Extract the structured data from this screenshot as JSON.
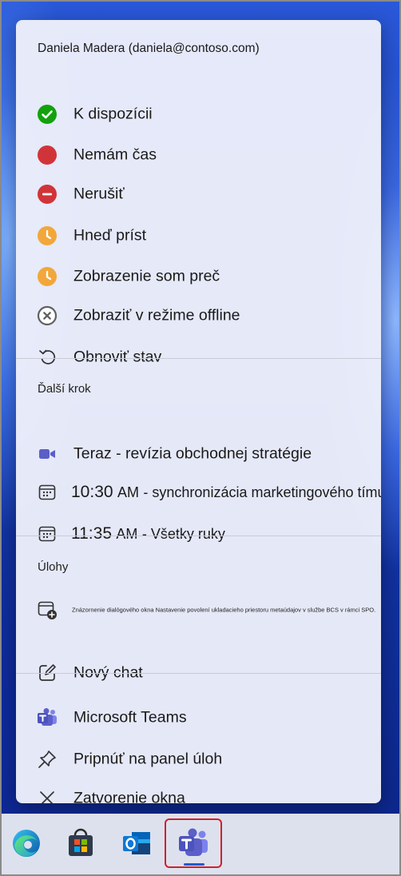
{
  "account": "Daniela Madera (daniela@contoso.com)",
  "status_items": [
    {
      "label": "K dispozícii",
      "icon": "available-icon",
      "color": "#13a10e"
    },
    {
      "label": "Nemám čas",
      "icon": "busy-icon",
      "color": "#d13438"
    },
    {
      "label": "Nerušiť",
      "icon": "do-not-disturb-icon",
      "color": "#d13438"
    },
    {
      "label": "Hneď príst",
      "icon": "be-right-back-icon",
      "color": "#f2a73b"
    },
    {
      "label": "Zobrazenie som preč",
      "icon": "away-icon",
      "color": "#f2a73b"
    },
    {
      "label": "Zobraziť v režime offline",
      "icon": "offline-icon",
      "color": "#606060"
    },
    {
      "label": "Obnoviť stav",
      "icon": "reset-icon",
      "color": "#333333"
    }
  ],
  "next_section": "Ďalší krok",
  "events": [
    {
      "label": "Teraz - revízia obchodnej stratégie",
      "icon": "video-icon"
    },
    {
      "time": "10:30",
      "ampm": "AM",
      "title": "- synchronizácia marketingového tímu",
      "icon": "calendar-icon"
    },
    {
      "time": "11:35",
      "ampm": "AM",
      "title": "- Všetky ruky",
      "icon": "calendar-icon"
    }
  ],
  "tasks_section": "Úlohy",
  "tasks": [
    {
      "label": "Znázornenie dialógového okna Nastavenie povolení ukladacieho priestoru metaúdajov v službe BCS v rámci SPO.",
      "icon": "new-meeting-icon"
    },
    {
      "label": "Nový chat",
      "icon": "new-chat-icon"
    }
  ],
  "app_items": [
    {
      "label": "Microsoft Teams",
      "icon": "teams-icon"
    },
    {
      "label": "Pripnúť na panel úloh",
      "icon": "pin-icon"
    },
    {
      "label": "Zatvorenie okna",
      "icon": "close-icon"
    }
  ],
  "taskbar": [
    {
      "name": "edge-icon"
    },
    {
      "name": "store-icon"
    },
    {
      "name": "outlook-icon"
    },
    {
      "name": "teams-taskbar-icon",
      "active": true
    }
  ],
  "colors": {
    "highlight": "#d0202a",
    "teams_purple": "#5b5fc7",
    "accent": "#1b5fd1"
  }
}
